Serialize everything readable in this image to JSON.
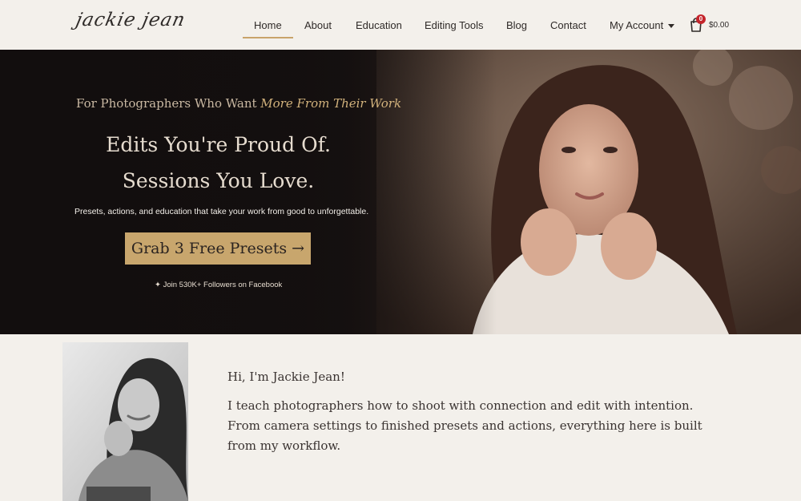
{
  "header": {
    "logo": "jackie jean",
    "nav": [
      "Home",
      "About",
      "Education",
      "Editing Tools",
      "Blog",
      "Contact",
      "My Account"
    ],
    "cart": {
      "count": "0",
      "total": "$0.00"
    }
  },
  "hero": {
    "tagline_prefix": "For Photographers Who Want ",
    "tagline_emphasis": "More From Their Work",
    "headline_1": "Edits You're Proud Of.",
    "headline_2": "Sessions You Love.",
    "subtext": "Presets, actions, and education that take your work from good to unforgettable.",
    "cta": "Grab 3 Free Presets →",
    "facebook_link": "✦ Join 530K+ Followers on Facebook"
  },
  "about": {
    "greeting": "Hi, I'm Jackie Jean!",
    "text": "I teach photographers how to shoot with connection and edit with intention. From camera settings to finished presets and actions, everything here is built from my workflow."
  },
  "colors": {
    "accent_gold": "#c8a66d",
    "background": "#f3f0eb",
    "cart_badge": "#c4242b"
  }
}
